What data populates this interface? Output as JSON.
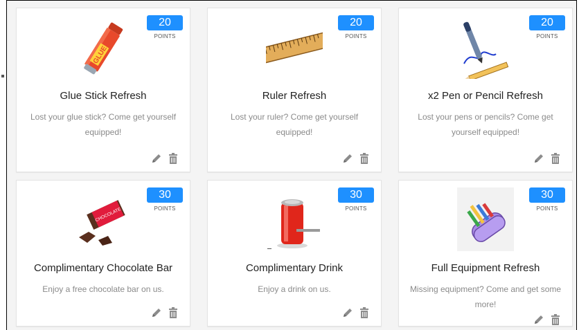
{
  "rewards": [
    {
      "points": "20",
      "points_label": "POINTS",
      "title": "Glue Stick Refresh",
      "description": "Lost your glue stick? Come get yourself equipped!",
      "icon": "glue-stick-icon"
    },
    {
      "points": "20",
      "points_label": "POINTS",
      "title": "Ruler Refresh",
      "description": "Lost your ruler? Come get yourself equipped!",
      "icon": "ruler-icon"
    },
    {
      "points": "20",
      "points_label": "POINTS",
      "title": "x2 Pen or Pencil Refresh",
      "description": "Lost your pens or pencils? Come get yourself equipped!",
      "icon": "pen-pencil-icon"
    },
    {
      "points": "30",
      "points_label": "POINTS",
      "title": "Complimentary Chocolate Bar",
      "description": "Enjoy a free chocolate bar on us.",
      "icon": "chocolate-bar-icon"
    },
    {
      "points": "30",
      "points_label": "POINTS",
      "title": "Complimentary Drink",
      "description": "Enjoy a drink on us.",
      "icon": "drink-can-icon"
    },
    {
      "points": "30",
      "points_label": "POINTS",
      "title": "Full Equipment Refresh",
      "description": "Missing equipment? Come and get some more!",
      "icon": "pencil-case-icon"
    }
  ],
  "images": {
    "glue_label": "GLUE",
    "chocolate_label": "CHOCOLATE"
  },
  "colors": {
    "badge": "#1e90ff",
    "action_icon": "#8c8c8c"
  }
}
